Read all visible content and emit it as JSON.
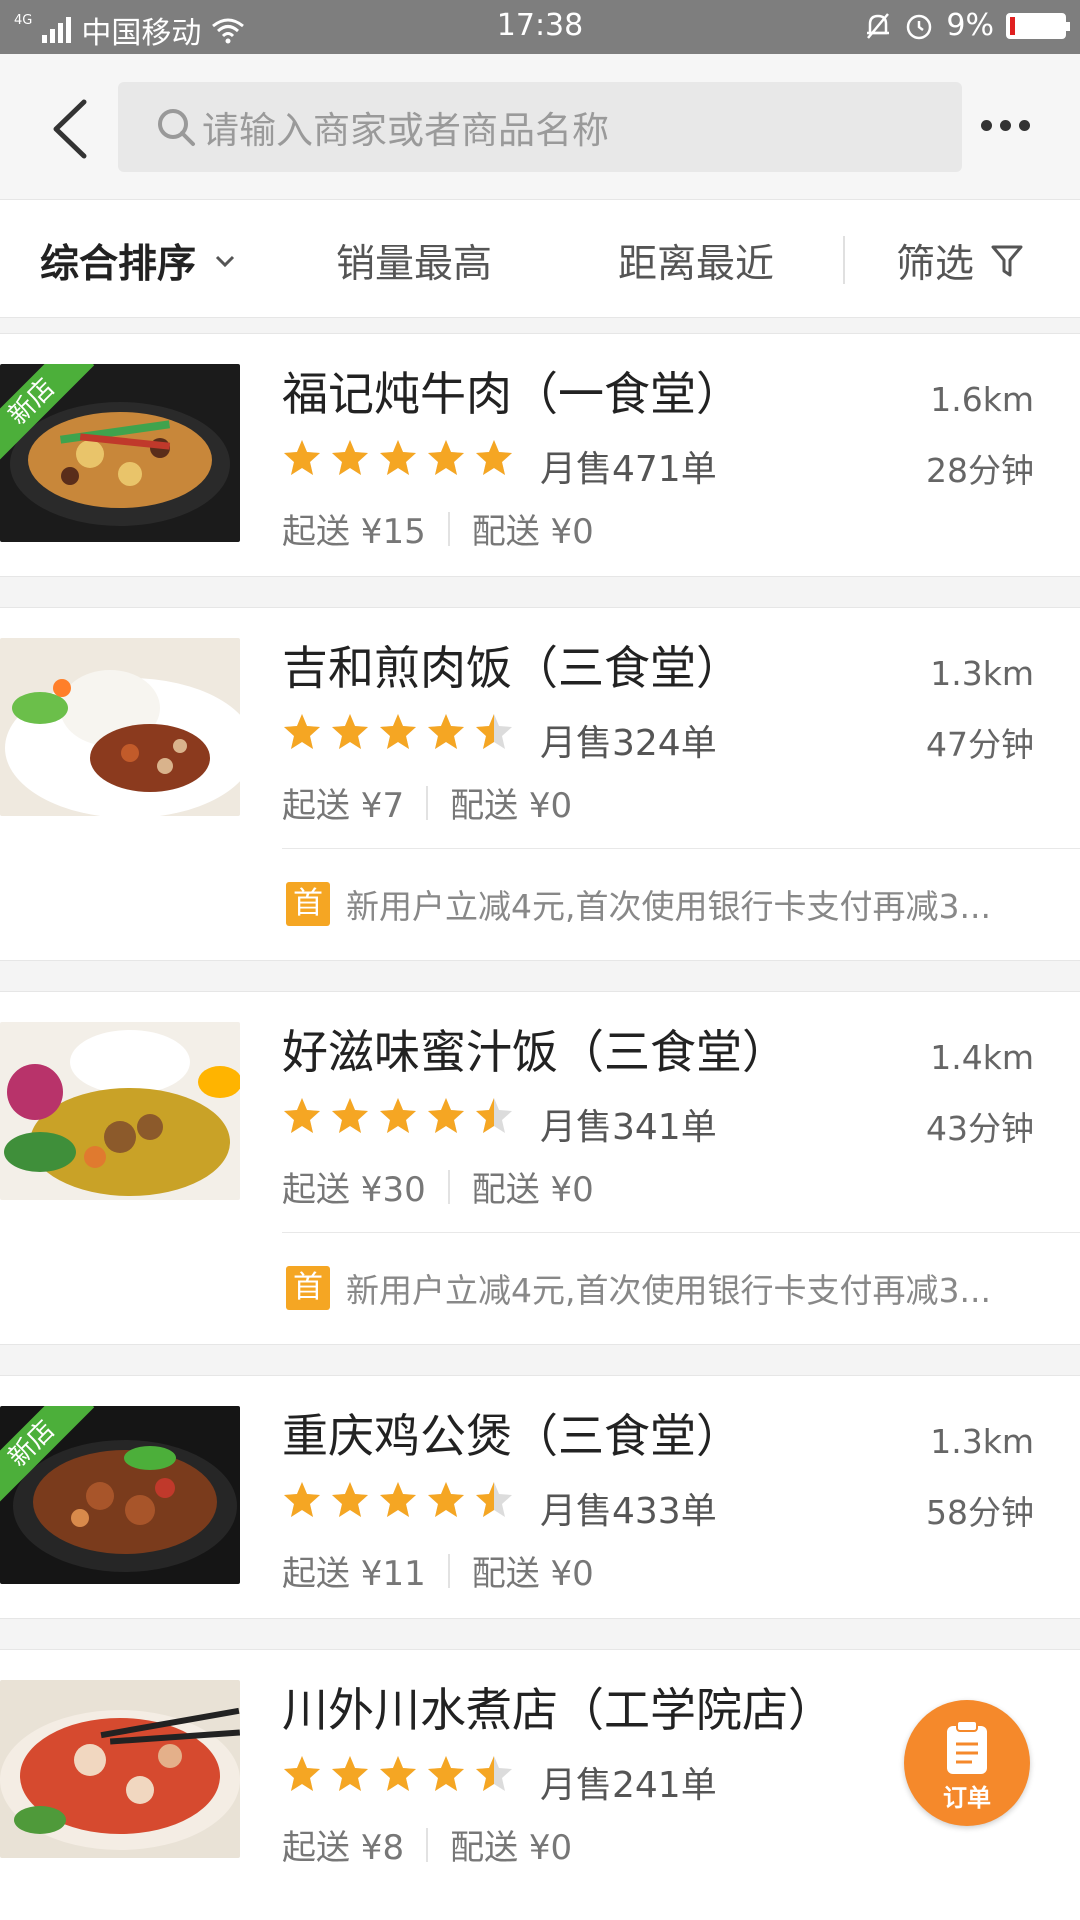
{
  "status_bar": {
    "network": "4G",
    "carrier": "中国移动",
    "time": "17:38",
    "battery": "9%",
    "battery_fill": 0.09,
    "icons": [
      "signal-icon",
      "wifi-icon",
      "bell-off-icon",
      "alarm-icon",
      "battery-icon"
    ]
  },
  "nav": {
    "search_placeholder": "请输入商家或者商品名称",
    "icons": [
      "back-icon",
      "search-icon",
      "more-icon"
    ]
  },
  "filters": {
    "sort": "综合排序",
    "sales": "销量最高",
    "distance": "距离最近",
    "filter": "筛选"
  },
  "stores": [
    {
      "name": "福记炖牛肉（一食堂）",
      "badge": "新店",
      "rating": 5,
      "sold": "月售471单",
      "min_order": "起送 ¥15",
      "delivery": "配送 ¥0",
      "distance": "1.6km",
      "time": "28分钟"
    },
    {
      "name": "吉和煎肉饭（三食堂）",
      "rating": 4.5,
      "sold": "月售324单",
      "min_order": "起送 ¥7",
      "delivery": "配送 ¥0",
      "distance": "1.3km",
      "time": "47分钟",
      "promo_tag": "首",
      "promo": "新用户立减4元,首次使用银行卡支付再减3..."
    },
    {
      "name": "好滋味蜜汁饭（三食堂）",
      "rating": 4.5,
      "sold": "月售341单",
      "min_order": "起送 ¥30",
      "delivery": "配送 ¥0",
      "distance": "1.4km",
      "time": "43分钟",
      "promo_tag": "首",
      "promo": "新用户立减4元,首次使用银行卡支付再减3..."
    },
    {
      "name": "重庆鸡公煲（三食堂）",
      "badge": "新店",
      "rating": 4.5,
      "sold": "月售433单",
      "min_order": "起送 ¥11",
      "delivery": "配送 ¥0",
      "distance": "1.3km",
      "time": "58分钟"
    },
    {
      "name": "川外川水煮店（工学院店）",
      "rating": 4.5,
      "sold": "月售241单",
      "min_order": "起送 ¥8",
      "delivery": "配送 ¥0"
    }
  ],
  "fab": {
    "label": "订单",
    "icon": "clipboard-icon"
  },
  "colors": {
    "accent": "#f5892b",
    "star": "#f5a623",
    "badge_green": "#4caf3a",
    "status_bar": "#7e7e7e"
  }
}
